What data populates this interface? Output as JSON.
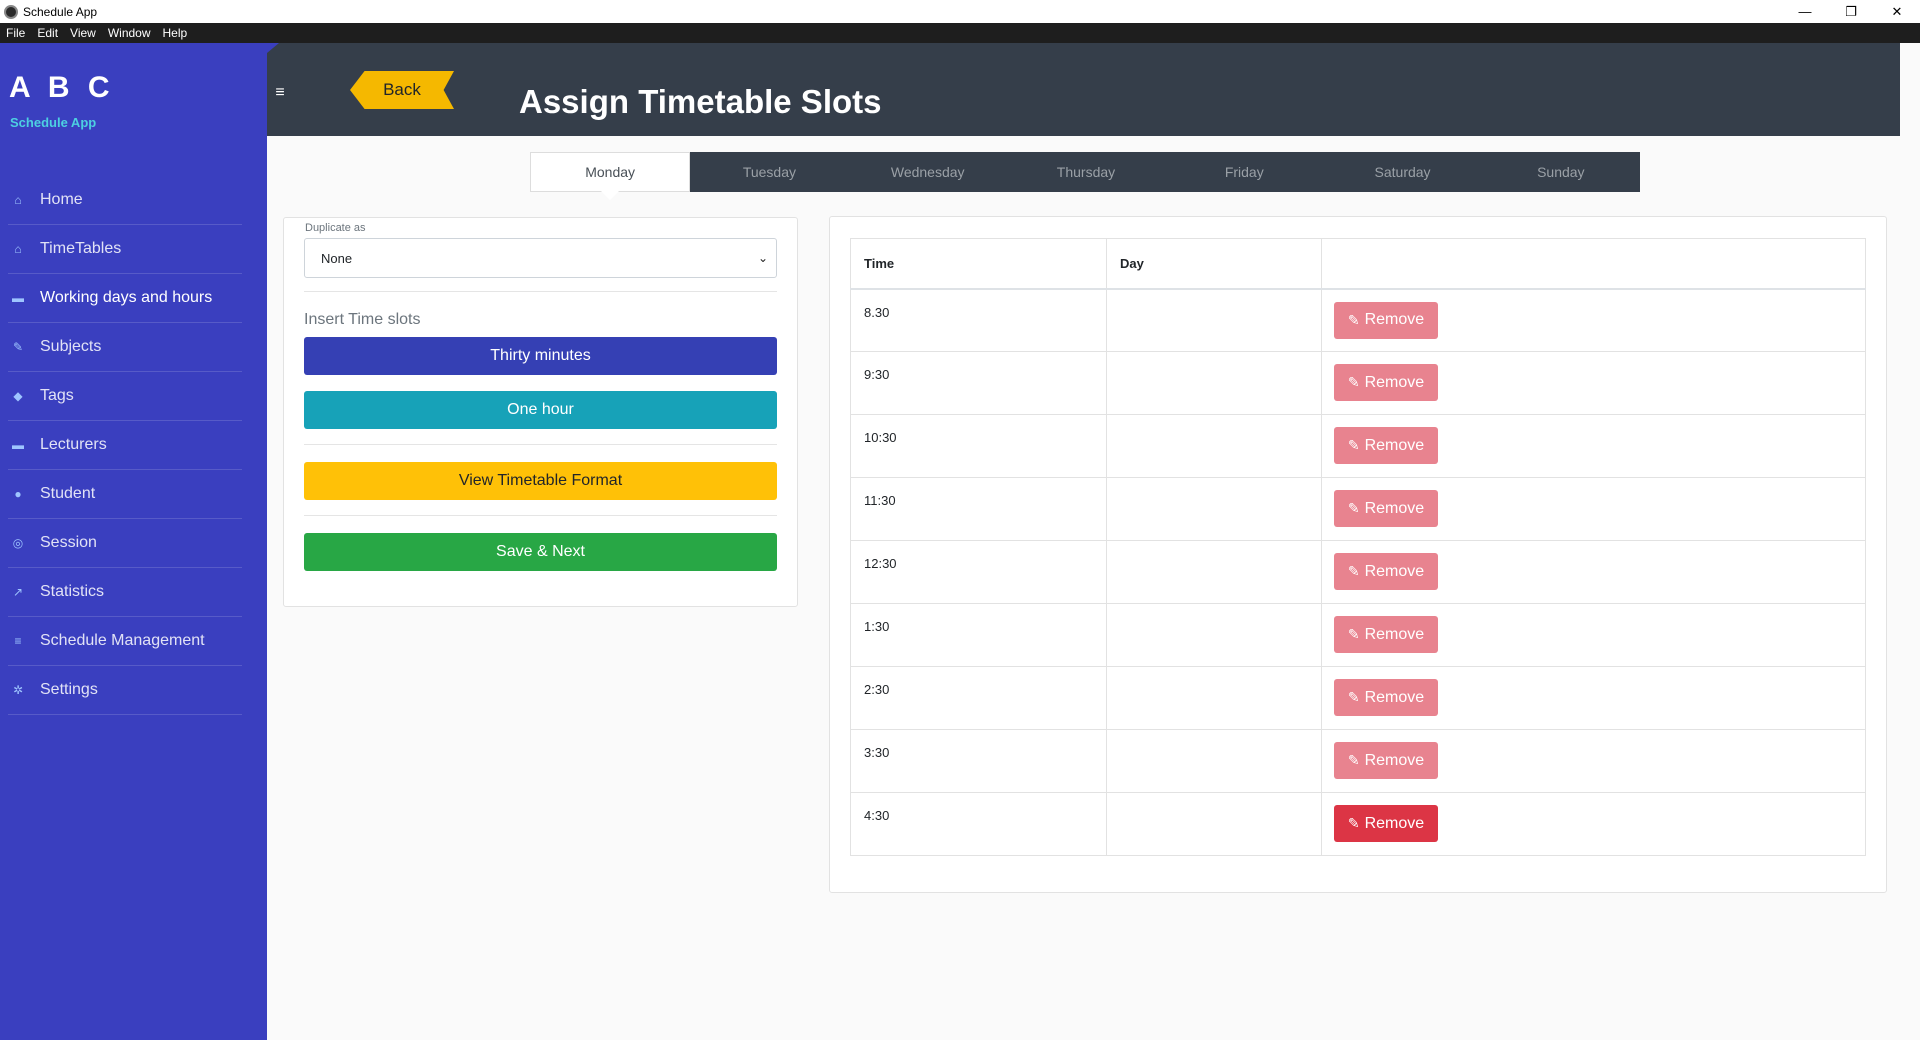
{
  "window": {
    "title": "Schedule App",
    "controls": {
      "minimize": "—",
      "restore": "❐",
      "close": "✕"
    }
  },
  "menu": [
    "File",
    "Edit",
    "View",
    "Window",
    "Help"
  ],
  "sidebar": {
    "brand": "A B C",
    "subtitle": "Schedule App",
    "items": [
      {
        "label": "Home",
        "icon": "home-icon",
        "glyph": "⌂"
      },
      {
        "label": "TimeTables",
        "icon": "home-icon",
        "glyph": "⌂"
      },
      {
        "label": "Working days and hours",
        "icon": "briefcase-icon",
        "glyph": "▬"
      },
      {
        "label": "Subjects",
        "icon": "paperclip-icon",
        "glyph": "✎"
      },
      {
        "label": "Tags",
        "icon": "tag-icon",
        "glyph": "◆"
      },
      {
        "label": "Lecturers",
        "icon": "briefcase-icon",
        "glyph": "▬"
      },
      {
        "label": "Student",
        "icon": "user-icon",
        "glyph": "●"
      },
      {
        "label": "Session",
        "icon": "globe-icon",
        "glyph": "◎"
      },
      {
        "label": "Statistics",
        "icon": "line-chart-icon",
        "glyph": "↗"
      },
      {
        "label": "Schedule Management",
        "icon": "list-icon",
        "glyph": "≡"
      },
      {
        "label": "Settings",
        "icon": "gears-icon",
        "glyph": "✲"
      }
    ],
    "active_index": 2
  },
  "header": {
    "back_label": "Back",
    "title": "Assign Timetable Slots",
    "menu_icon_glyph": "≡"
  },
  "days": [
    "Monday",
    "Tuesday",
    "Wednesday",
    "Thursday",
    "Friday",
    "Saturday",
    "Sunday"
  ],
  "active_day": "Monday",
  "form": {
    "duplicate_label": "Duplicate as",
    "duplicate_value": "None",
    "insert_label": "Insert Time slots",
    "thirty_label": "Thirty minutes",
    "hour_label": "One hour",
    "view_label": "View Timetable Format",
    "save_label": "Save & Next"
  },
  "table": {
    "headers": [
      "Time",
      "Day",
      ""
    ],
    "remove_label": "Remove",
    "rows": [
      {
        "time": "8.30",
        "day": ""
      },
      {
        "time": "9:30",
        "day": ""
      },
      {
        "time": "10:30",
        "day": ""
      },
      {
        "time": "11:30",
        "day": ""
      },
      {
        "time": "12:30",
        "day": ""
      },
      {
        "time": "1:30",
        "day": ""
      },
      {
        "time": "2:30",
        "day": ""
      },
      {
        "time": "3:30",
        "day": ""
      },
      {
        "time": "4:30",
        "day": ""
      }
    ]
  },
  "colors": {
    "sidebar": "#3a3fbf",
    "header": "#353e4a",
    "primary": "#3540b4",
    "info": "#17a2b8",
    "warning": "#ffc107",
    "success": "#28a745",
    "danger": "#dc3545",
    "danger_light": "#e8838f"
  }
}
